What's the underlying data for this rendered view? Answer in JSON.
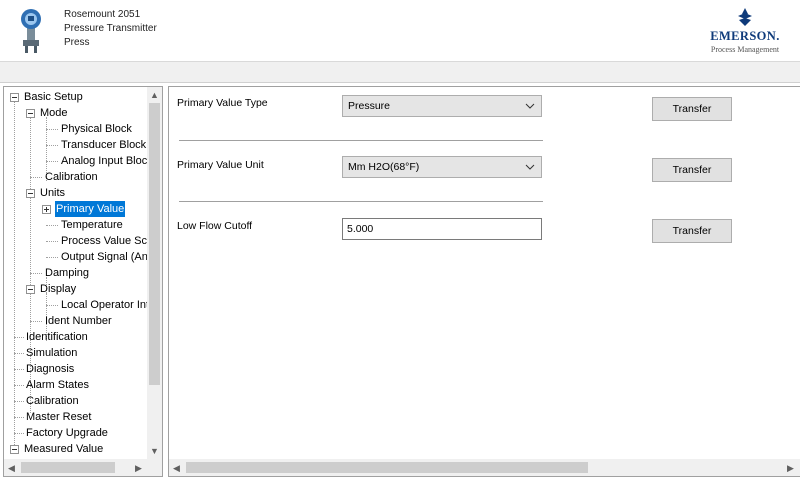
{
  "device": {
    "model": "Rosemount 2051",
    "type_line1": "Pressure Transmitter",
    "type_line2": "Press",
    "icon": "pressure-transmitter-icon"
  },
  "logo": {
    "name": "EMERSON.",
    "subtitle": "Process Management",
    "brand_color": "#0e3a7a"
  },
  "tree": {
    "items": [
      {
        "label": "Basic Setup",
        "expanded": true
      },
      {
        "label": "Mode",
        "expanded": true
      },
      {
        "label": "Physical Block"
      },
      {
        "label": "Transducer Block"
      },
      {
        "label": "Analog Input Block"
      },
      {
        "label": "Calibration"
      },
      {
        "label": "Units",
        "expanded": true
      },
      {
        "label": "Primary Value",
        "selected": true,
        "expanded": false
      },
      {
        "label": "Temperature"
      },
      {
        "label": "Process Value Scale"
      },
      {
        "label": "Output Signal (Analog)"
      },
      {
        "label": "Damping"
      },
      {
        "label": "Display",
        "expanded": true
      },
      {
        "label": "Local Operator Interface"
      },
      {
        "label": "Ident Number"
      },
      {
        "label": "Identification"
      },
      {
        "label": "Simulation"
      },
      {
        "label": "Diagnosis"
      },
      {
        "label": "Alarm States"
      },
      {
        "label": "Calibration"
      },
      {
        "label": "Master Reset"
      },
      {
        "label": "Factory Upgrade"
      },
      {
        "label": "Measured Value",
        "expanded": true
      }
    ],
    "selection_color": "#0078d7"
  },
  "form": {
    "primary_value_type": {
      "label": "Primary Value Type",
      "value": "Pressure",
      "button": "Transfer"
    },
    "primary_value_unit": {
      "label": "Primary Value Unit",
      "value": "Mm H2O(68°F)",
      "button": "Transfer"
    },
    "low_flow_cutoff": {
      "label": "Low Flow Cutoff",
      "value": "5.000",
      "button": "Transfer"
    }
  }
}
